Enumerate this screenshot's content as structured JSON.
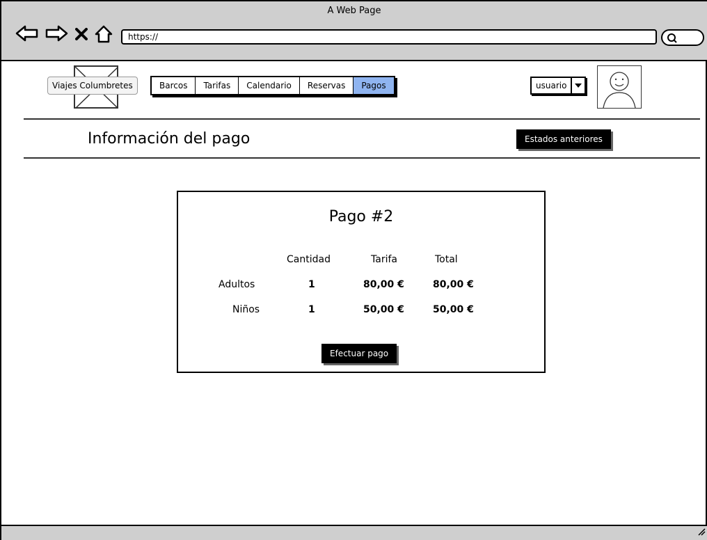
{
  "window": {
    "title": "A Web Page"
  },
  "browser": {
    "url": "https://"
  },
  "header": {
    "brand_label": "Viajes Columbretes",
    "tabs": [
      {
        "label": "Barcos",
        "active": false
      },
      {
        "label": "Tarifas",
        "active": false
      },
      {
        "label": "Calendario",
        "active": false
      },
      {
        "label": "Reservas",
        "active": false
      },
      {
        "label": "Pagos",
        "active": true
      }
    ],
    "user_select": {
      "value": "usuario"
    }
  },
  "page": {
    "title": "Información del pago",
    "previous_states_button": "Estados anteriores"
  },
  "payment": {
    "title": "Pago #2",
    "columns": [
      "Cantidad",
      "Tarifa",
      "Total"
    ],
    "rows": [
      {
        "label": "Adultos",
        "cantidad": "1",
        "tarifa": "80,00 €",
        "total": "80,00 €"
      },
      {
        "label": "Niños",
        "cantidad": "1",
        "tarifa": "50,00 €",
        "total": "50,00 €"
      }
    ],
    "pay_button": "Efectuar pago"
  },
  "colors": {
    "active_tab": "#8fb4f0",
    "chrome": "#cfcfcf",
    "button": "#000000"
  }
}
